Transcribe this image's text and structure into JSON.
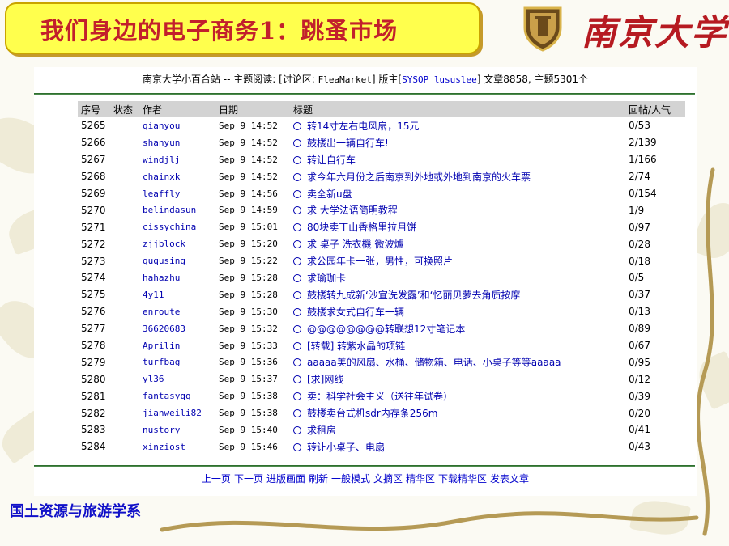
{
  "slide": {
    "title": "我们身边的电子商务1：跳蚤市场",
    "university": "南京大学",
    "department": "国土资源与旅游学系"
  },
  "board": {
    "prefix": "南京大学小百合站 -- 主题阅读: [讨论区: ",
    "board_name": "FleaMarket",
    "mid": "] 版主[",
    "moderators": "SYSOP lususlee",
    "suffix": "] 文章8858, 主题5301个"
  },
  "columns": [
    "序号",
    "状态",
    "作者",
    "日期",
    "标题",
    "回帖/人气"
  ],
  "posts": [
    {
      "num": "5265",
      "status": "",
      "author": "qianyou",
      "date": "Sep 9 14:52",
      "title": "转14寸左右电风扇，15元",
      "replies": "0/53"
    },
    {
      "num": "5266",
      "status": "",
      "author": "shanyun",
      "date": "Sep 9 14:52",
      "title": "鼓楼出一辆自行车!",
      "replies": "2/139"
    },
    {
      "num": "5267",
      "status": "",
      "author": "windjlj",
      "date": "Sep 9 14:52",
      "title": "转让自行车",
      "replies": "1/166"
    },
    {
      "num": "5268",
      "status": "",
      "author": "chainxk",
      "date": "Sep 9 14:52",
      "title": "求今年六月份之后南京到外地或外地到南京的火车票",
      "replies": "2/74"
    },
    {
      "num": "5269",
      "status": "",
      "author": "leaffly",
      "date": "Sep 9 14:56",
      "title": "卖全新u盘",
      "replies": "0/154"
    },
    {
      "num": "5270",
      "status": "",
      "author": "belindasun",
      "date": "Sep 9 14:59",
      "title": "求 大学法语简明教程",
      "replies": "1/9"
    },
    {
      "num": "5271",
      "status": "",
      "author": "cissychina",
      "date": "Sep 9 15:01",
      "title": "80块卖丁山香格里拉月饼",
      "replies": "0/97"
    },
    {
      "num": "5272",
      "status": "",
      "author": "zjjblock",
      "date": "Sep 9 15:20",
      "title": "求 桌子 洗衣機 微波爐",
      "replies": "0/28"
    },
    {
      "num": "5273",
      "status": "",
      "author": "ququsing",
      "date": "Sep 9 15:22",
      "title": "求公园年卡一张，男性，可换照片",
      "replies": "0/18"
    },
    {
      "num": "5274",
      "status": "",
      "author": "hahazhu",
      "date": "Sep 9 15:28",
      "title": "求瑜珈卡",
      "replies": "0/5"
    },
    {
      "num": "5275",
      "status": "",
      "author": "4y11",
      "date": "Sep 9 15:28",
      "title": "鼓楼转九成新‘沙宣洗发露’和‘忆丽贝萝去角质按摩",
      "replies": "0/37"
    },
    {
      "num": "5276",
      "status": "",
      "author": "enroute",
      "date": "Sep 9 15:30",
      "title": "鼓楼求女式自行车一辆",
      "replies": "0/13"
    },
    {
      "num": "5277",
      "status": "",
      "author": "36620683",
      "date": "Sep 9 15:32",
      "title": "@@@@@@@@转联想12寸笔记本",
      "replies": "0/89"
    },
    {
      "num": "5278",
      "status": "",
      "author": "Aprilin",
      "date": "Sep 9 15:33",
      "title": "[转载] 转紫水晶的项链",
      "replies": "0/67"
    },
    {
      "num": "5279",
      "status": "",
      "author": "turfbag",
      "date": "Sep 9 15:36",
      "title": "aaaaa美的风扇、水桶、储物箱、电话、小桌子等等aaaaa",
      "replies": "0/95"
    },
    {
      "num": "5280",
      "status": "",
      "author": "yl36",
      "date": "Sep 9 15:37",
      "title": "[求]网线",
      "replies": "0/12"
    },
    {
      "num": "5281",
      "status": "",
      "author": "fantasyqq",
      "date": "Sep 9 15:38",
      "title": "卖：科学社会主义（送往年试卷）",
      "replies": "0/39"
    },
    {
      "num": "5282",
      "status": "",
      "author": "jianweili82",
      "date": "Sep 9 15:38",
      "title": "鼓楼卖台式机sdr内存条256m",
      "replies": "0/20"
    },
    {
      "num": "5283",
      "status": "",
      "author": "nustory",
      "date": "Sep 9 15:40",
      "title": "求租房",
      "replies": "0/41"
    },
    {
      "num": "5284",
      "status": "",
      "author": "xinziost",
      "date": "Sep 9 15:46",
      "title": "转让小桌子、电扇",
      "replies": "0/43"
    }
  ],
  "nav": [
    "上一页",
    "下一页",
    "进版画面",
    "刷新",
    "一般模式",
    "文摘区",
    "精华区",
    "下载精华区",
    "发表文章"
  ],
  "colors": {
    "title_bg": "#ffff4d",
    "title_text": "#c2202c",
    "link": "#0000b0",
    "logo": "#b61a21",
    "dept": "#1010c8"
  }
}
